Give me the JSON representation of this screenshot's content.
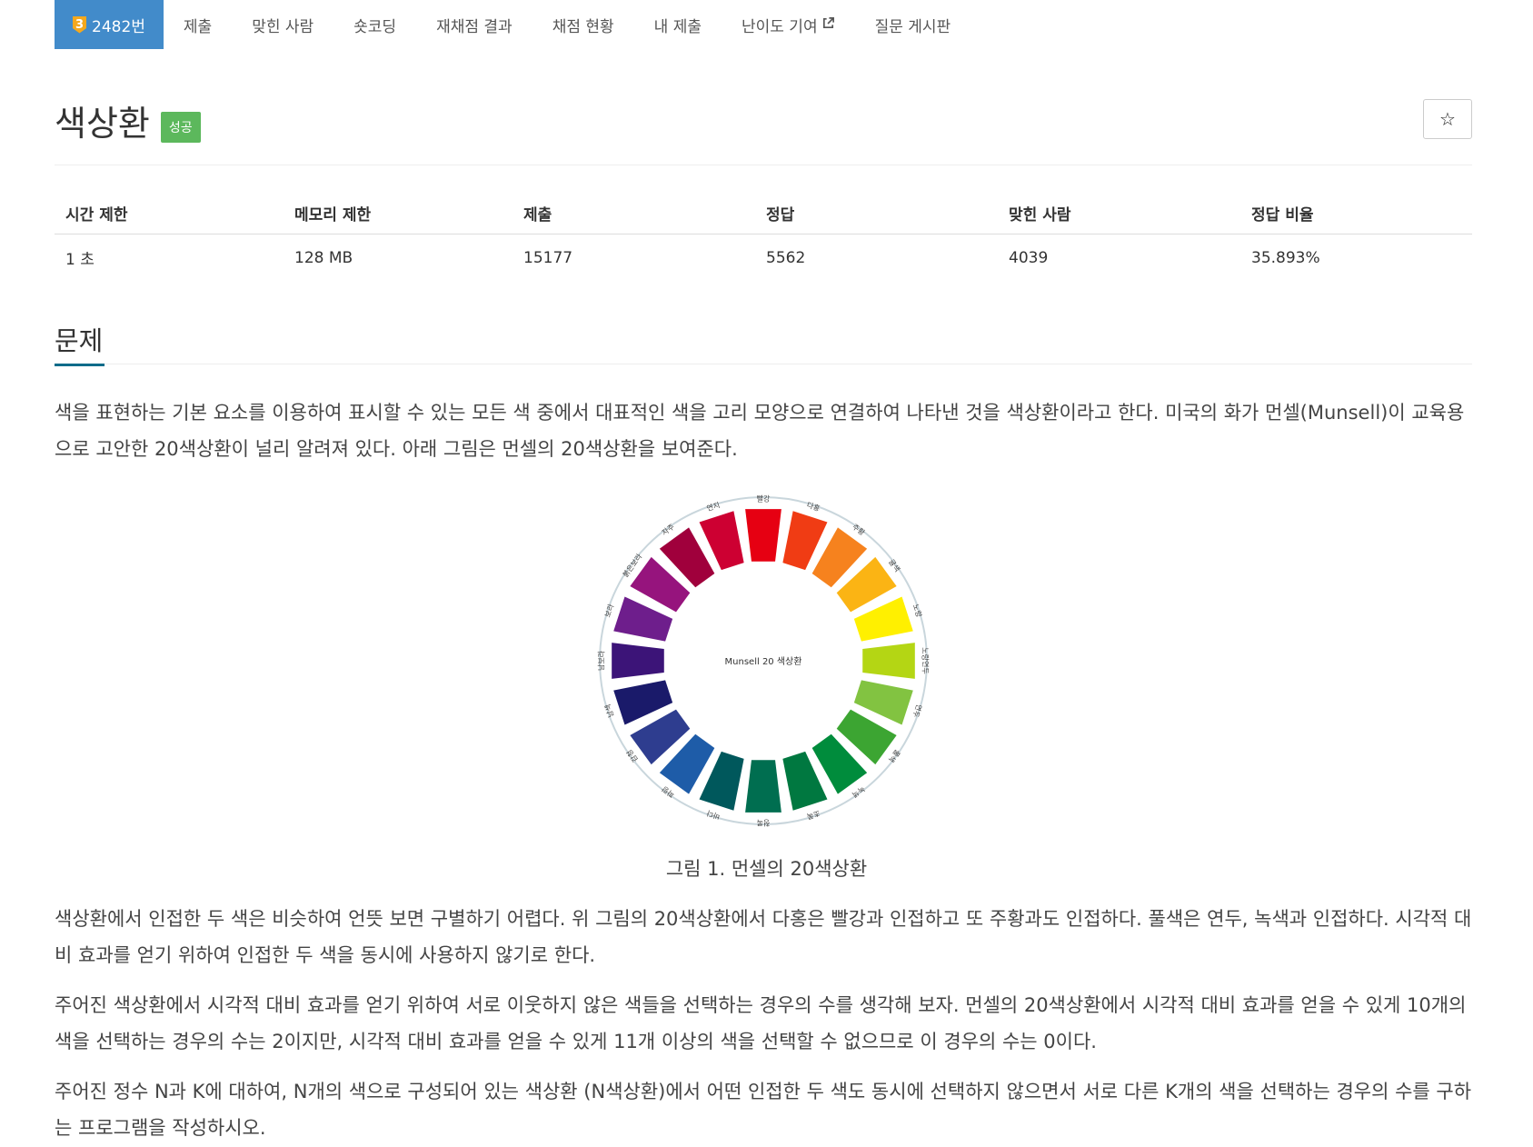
{
  "tabs": {
    "tier_badge": "3",
    "problem_number": "2482번",
    "items": [
      "제출",
      "맞힌 사람",
      "숏코딩",
      "재채점 결과",
      "채점 현황",
      "내 제출",
      "난이도 기여",
      "질문 게시판"
    ]
  },
  "title": "색상환",
  "status_badge": "성공",
  "star_icon": "star-outline-icon",
  "info": {
    "headers": [
      "시간 제한",
      "메모리 제한",
      "제출",
      "정답",
      "맞힌 사람",
      "정답 비율"
    ],
    "values": [
      "1 초",
      "128 MB",
      "15177",
      "5562",
      "4039",
      "35.893%"
    ]
  },
  "section_title": "문제",
  "paragraphs": [
    "색을 표현하는 기본 요소를 이용하여 표시할 수 있는 모든 색 중에서 대표적인 색을 고리 모양으로 연결하여 나타낸 것을 색상환이라고 한다. 미국의 화가 먼셀(Munsell)이 교육용으로 고안한 20색상환이 널리 알려져 있다. 아래 그림은 먼셀의 20색상환을 보여준다.",
    "색상환에서 인접한 두 색은 비슷하여 언뜻 보면 구별하기 어렵다. 위 그림의 20색상환에서 다홍은 빨강과 인접하고 또 주황과도 인접하다. 풀색은 연두, 녹색과 인접하다. 시각적 대비 효과를 얻기 위하여 인접한 두 색을 동시에 사용하지 않기로 한다.",
    "주어진 색상환에서 시각적 대비 효과를 얻기 위하여 서로 이웃하지 않은 색들을 선택하는 경우의 수를 생각해 보자.  먼셀의 20색상환에서 시각적 대비 효과를 얻을 수 있게 10개의 색을 선택하는 경우의 수는 2이지만, 시각적 대비 효과를 얻을 수 있게 11개 이상의 색을 선택할 수 없으므로 이 경우의 수는 0이다.",
    "주어진 정수 N과 K에 대하여, N개의 색으로 구성되어 있는 색상환 (N색상환)에서 어떤 인접한 두 색도 동시에 선택하지 않으면서 서로 다른 K개의 색을 선택하는 경우의 수를 구하는 프로그램을 작성하시오."
  ],
  "wheel": {
    "center_label": "Munsell 20 색상환",
    "segments": [
      {
        "name": "빨강",
        "color": "#e60012"
      },
      {
        "name": "다홍",
        "color": "#f03c14"
      },
      {
        "name": "주황",
        "color": "#f6821e"
      },
      {
        "name": "귤색",
        "color": "#fbb414"
      },
      {
        "name": "노랑",
        "color": "#fff000"
      },
      {
        "name": "노랑연두",
        "color": "#b4d614"
      },
      {
        "name": "연두",
        "color": "#82c341"
      },
      {
        "name": "풀색",
        "color": "#3ca532"
      },
      {
        "name": "녹색",
        "color": "#008c3c"
      },
      {
        "name": "초록",
        "color": "#007840"
      },
      {
        "name": "청록",
        "color": "#006e50"
      },
      {
        "name": "바다",
        "color": "#00585c"
      },
      {
        "name": "파랑",
        "color": "#1e5ca8"
      },
      {
        "name": "감청",
        "color": "#2e3d8f"
      },
      {
        "name": "남색",
        "color": "#1a1a6a"
      },
      {
        "name": "남보라",
        "color": "#3c1478"
      },
      {
        "name": "보라",
        "color": "#6e1e8c"
      },
      {
        "name": "붉은보라",
        "color": "#96147d"
      },
      {
        "name": "자주",
        "color": "#a0003c"
      },
      {
        "name": "연지",
        "color": "#cd0032"
      }
    ]
  },
  "caption": "그림 1. 먼셀의 20색상환"
}
